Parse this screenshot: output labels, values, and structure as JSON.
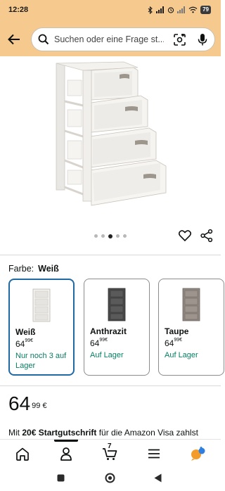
{
  "status": {
    "time": "12:28",
    "battery": "79"
  },
  "search": {
    "placeholder": "Suchen oder eine Frage st..."
  },
  "gallery": {
    "dot_count": 5,
    "active_index": 2
  },
  "color": {
    "label": "Farbe:",
    "selected": "Weiß"
  },
  "variants": [
    {
      "name": "Weiß",
      "price_whole": "64",
      "price_fraction": "99",
      "currency": "€",
      "stock": "Nur noch 3 auf Lager",
      "selected": true,
      "swatch": "#f2f1ee"
    },
    {
      "name": "Anthrazit",
      "price_whole": "64",
      "price_fraction": "99",
      "currency": "€",
      "stock": "Auf Lager",
      "selected": false,
      "swatch": "#4a4a4a"
    },
    {
      "name": "Taupe",
      "price_whole": "64",
      "price_fraction": "99",
      "currency": "€",
      "stock": "Auf Lager",
      "selected": false,
      "swatch": "#8f8680"
    }
  ],
  "price": {
    "whole": "64",
    "fraction": "99",
    "currency": "€"
  },
  "promo": {
    "prefix": "Mit ",
    "amount": "20€ Startgutschrift",
    "suffix": " für die Amazon Visa zahlst"
  },
  "nav": {
    "cart_count": "7"
  },
  "colors": {
    "header_bg": "#f6ca8e",
    "stock_green": "#067d62",
    "selected_border": "#1f6aa5",
    "alexa_orange": "#f39c2c",
    "alexa_blue": "#2e7fe0"
  }
}
